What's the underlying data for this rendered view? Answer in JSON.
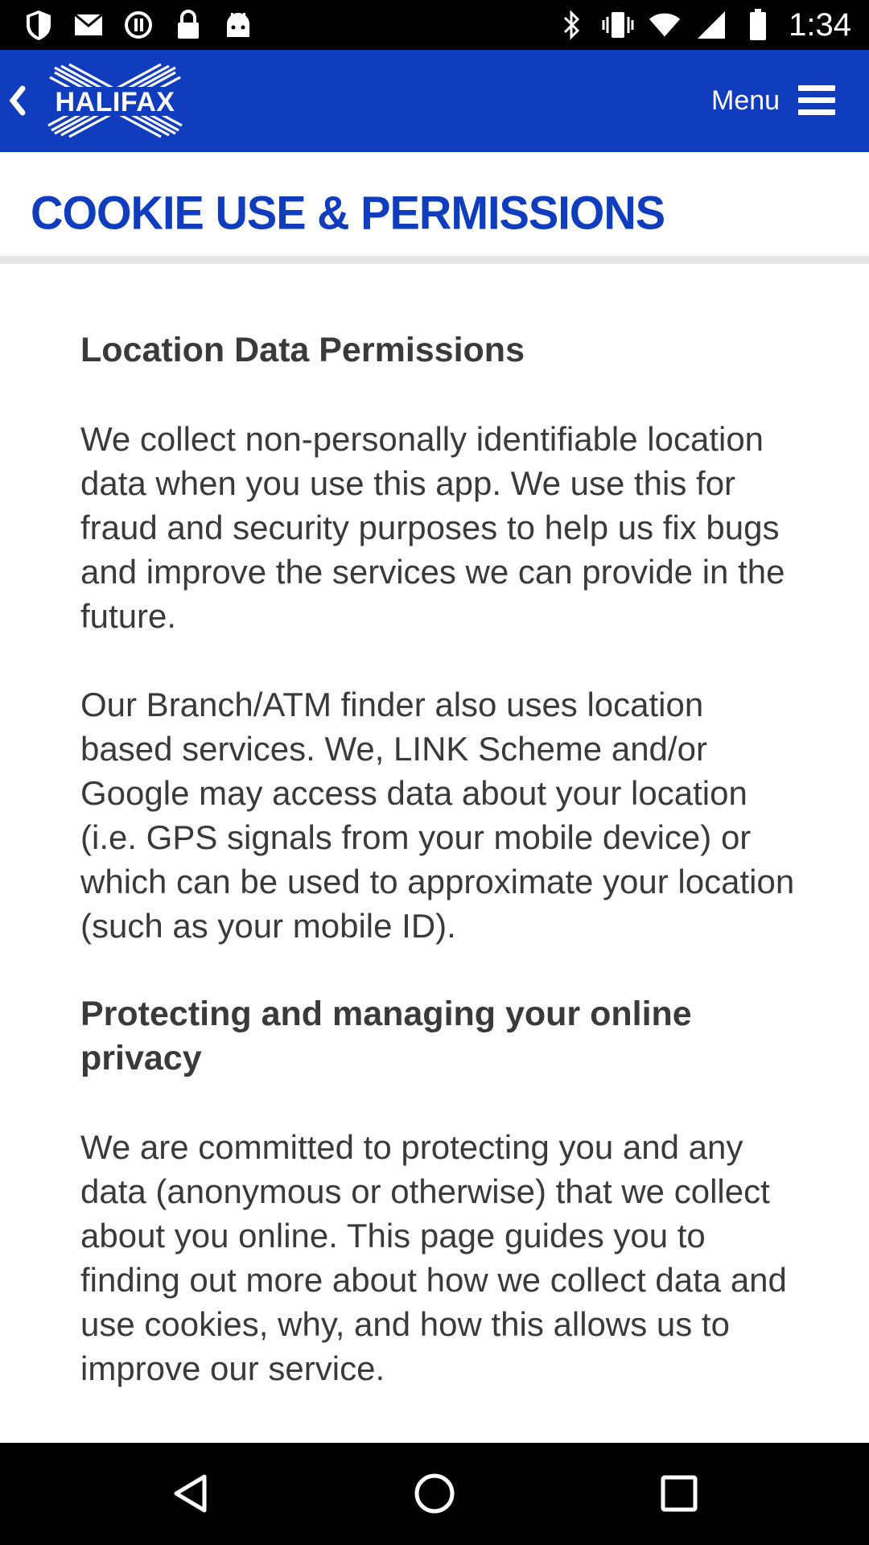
{
  "status_bar": {
    "time": "1:34",
    "left_icons": [
      "shield-icon",
      "mail-icon",
      "sync-icon",
      "lock-icon",
      "android-icon"
    ],
    "right_icons": [
      "bluetooth-icon",
      "vibrate-icon",
      "wifi-icon",
      "signal-icon",
      "battery-icon"
    ]
  },
  "header": {
    "brand": "HALIFAX",
    "menu_label": "Menu",
    "background_color": "#0f3dbd"
  },
  "page": {
    "title": "COOKIE USE & PERMISSIONS",
    "title_color": "#0f3dbd"
  },
  "content": {
    "section1_heading": "Location Data Permissions",
    "section1_para1": "We collect non-personally identifiable location data when you use this app. We use this for fraud and security purposes to help us fix bugs and improve the services we can provide in the future.",
    "section1_para2": "Our Branch/ATM finder also uses location based services. We, LINK Scheme and/or Google may access data about your location (i.e. GPS signals from your mobile device) or which can be used to approximate your location (such as your mobile ID).",
    "section2_heading": "Protecting and managing your online privacy",
    "section2_para1": "We are committed to protecting you and any data (anonymous or otherwise) that we collect about you online. This page guides you to finding out more about how we collect data and use cookies, why, and how this allows us to improve our service."
  },
  "nav_bar": {
    "buttons": [
      "back-icon",
      "home-icon",
      "recents-icon"
    ]
  }
}
